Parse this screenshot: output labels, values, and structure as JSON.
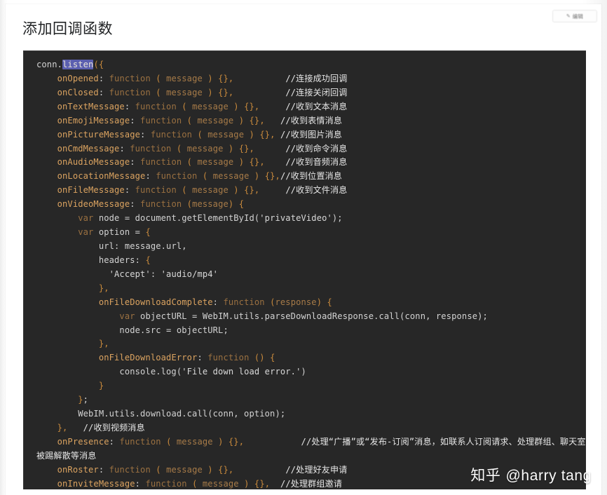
{
  "window": {
    "background_color": "#ffffff",
    "card_background": "#ffffff"
  },
  "corner_button": {
    "icon": "pin-icon",
    "label": "编辑"
  },
  "header": {
    "title": "添加回调函数"
  },
  "code_block": {
    "background_color": "#272727",
    "language": "javascript",
    "selection": {
      "text": "listen",
      "background_color": "#5b5fb0"
    },
    "colors": {
      "property": "#dba360",
      "keyword": "#9b7141",
      "punctuation": "#c98a3c",
      "plain": "#d3d3d3",
      "comment": "#e6e6e6"
    },
    "lines": [
      "conn.listen({",
      "    onOpened: function ( message ) {},          //连接成功回调",
      "    onClosed: function ( message ) {},          //连接关闭回调",
      "    onTextMessage: function ( message ) {},     //收到文本消息",
      "    onEmojiMessage: function ( message ) {},    //收到表情消息",
      "    onPictureMessage: function ( message ) {}, //收到图片消息",
      "    onCmdMessage: function ( message ) {},      //收到命令消息",
      "    onAudioMessage: function ( message ) {},    //收到音频消息",
      "    onLocationMessage: function ( message ) {},//收到位置消息",
      "    onFileMessage: function ( message ) {},     //收到文件消息",
      "    onVideoMessage: function (message) {",
      "        var node = document.getElementById('privateVideo');",
      "        var option = {",
      "            url: message.url,",
      "            headers: {",
      "              'Accept': 'audio/mp4'",
      "            },",
      "            onFileDownloadComplete: function (response) {",
      "                var objectURL = WebIM.utils.parseDownloadResponse.call(conn, response);",
      "                node.src = objectURL;",
      "            },",
      "            onFileDownloadError: function () {",
      "                console.log('File down load error.')",
      "            }",
      "        };",
      "        WebIM.utils.download.call(conn, option);",
      "    },   //收到视频消息",
      "    onPresence: function ( message ) {},           //处理“广播”或“发布-订阅”消息，如联系人订阅请求、处理群组、聊天室被踢解散等消息",
      "    onRoster: function ( message ) {},          //处理好友申请",
      "    onInviteMessage: function ( message ) {},  //处理群组邀请"
    ]
  },
  "watermark": {
    "site": "知乎",
    "handle": "@harry tang"
  }
}
